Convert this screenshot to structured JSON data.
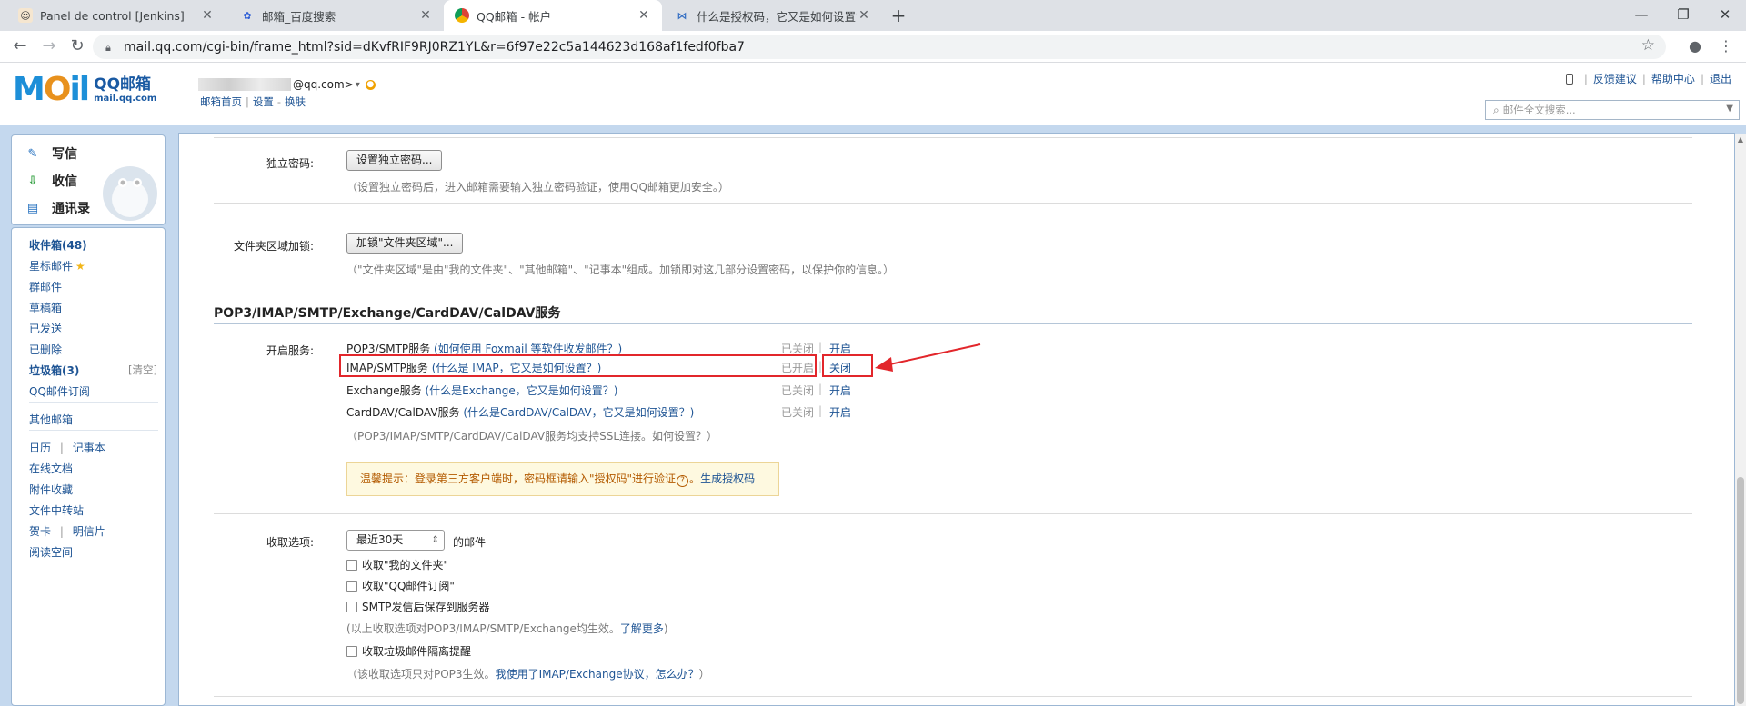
{
  "browser": {
    "tabs": [
      {
        "title": "Panel de control [Jenkins]",
        "icon": "jenkins-icon"
      },
      {
        "title": "邮箱_百度搜索",
        "icon": "baidu-icon"
      },
      {
        "title": "QQ邮箱 - 帐户",
        "icon": "chrome-icon"
      },
      {
        "title": "什么是授权码，它又是如何设置?",
        "icon": "qq-help-icon"
      }
    ],
    "new_tab": "+",
    "url": "mail.qq.com/cgi-bin/frame_html?sid=dKvfRIF9RJ0RZ1YL&r=6f97e22c5a144623d168af1fedf0fba7"
  },
  "header": {
    "logo_text": "MOil",
    "logo_brand": "QQ邮箱",
    "logo_domain": "mail.qq.com",
    "account_suffix": "@qq.com>",
    "account_caret": "▾",
    "sublinks": [
      "邮箱首页",
      "设置",
      "换肤"
    ],
    "sublink_separator": "|",
    "sublink_dash": "-",
    "top_links": [
      "反馈建议",
      "帮助中心",
      "退出"
    ],
    "search_placeholder": "邮件全文搜索..."
  },
  "sidebar": {
    "actions": [
      "写信",
      "收信",
      "通讯录"
    ],
    "folders": [
      {
        "label": "收件箱(48)",
        "bold": true
      },
      {
        "label": "星标邮件",
        "bold": false,
        "star": true
      },
      {
        "label": "群邮件",
        "bold": false
      },
      {
        "label": "草稿箱",
        "bold": false
      },
      {
        "label": "已发送",
        "bold": false
      },
      {
        "label": "已删除",
        "bold": false
      },
      {
        "label": "垃圾箱(3)",
        "bold": true
      },
      {
        "label": "QQ邮件订阅",
        "bold": false
      }
    ],
    "clean_label": "[清空]",
    "other_mailbox": "其他邮箱",
    "calendar": "日历",
    "notes": "记事本",
    "pipe": "|",
    "tools": [
      "在线文档",
      "附件收藏",
      "文件中转站"
    ],
    "card": "贺卡",
    "postcard": "明信片",
    "reading_space": "阅读空间"
  },
  "settings": {
    "independent_password_label": "独立密码:",
    "independent_password_button": "设置独立密码...",
    "independent_password_note": "（设置独立密码后，进入邮箱需要输入独立密码验证，使用QQ邮箱更加安全。）",
    "folder_lock_label": "文件夹区域加锁:",
    "folder_lock_button": "加锁\"文件夹区域\"...",
    "folder_lock_note": "（\"文件夹区域\"是由\"我的文件夹\"、\"其他邮箱\"、\"记事本\"组成。加锁即对这几部分设置密码，以保护你的信息。）",
    "section_title": "POP3/IMAP/SMTP/Exchange/CardDAV/CalDAV服务",
    "enable_service_label": "开启服务:",
    "services": [
      {
        "name": "POP3/SMTP服务",
        "help": "(如何使用 Foxmail 等软件收发邮件？)",
        "state": "已关闭",
        "toggle": "开启"
      },
      {
        "name": "IMAP/SMTP服务",
        "help": "(什么是 IMAP，它又是如何设置？)",
        "state": "已开启",
        "toggle": "关闭"
      },
      {
        "name": "Exchange服务",
        "help": "(什么是Exchange，它又是如何设置？)",
        "state": "已关闭",
        "toggle": "开启"
      },
      {
        "name": "CardDAV/CalDAV服务",
        "help": "(什么是CardDAV/CalDAV，它又是如何设置？)",
        "state": "已关闭",
        "toggle": "开启"
      }
    ],
    "ssl_note": "（POP3/IMAP/SMTP/CardDAV/CalDAV服务均支持SSL连接。如何设置？）",
    "tip_prefix": "温馨提示：登录第三方客户端时，密码框请输入\"授权码\"进行验证",
    "tip_help": "?",
    "tip_link": "生成授权码",
    "tip_end": "。",
    "receive_label": "收取选项:",
    "receive_period": "最近30天",
    "receive_suffix": "的邮件",
    "options": [
      {
        "label": "收取\"我的文件夹\"",
        "checked": false
      },
      {
        "label": "收取\"QQ邮件订阅\"",
        "checked": false
      },
      {
        "label": "SMTP发信后保存到服务器",
        "checked": false
      }
    ],
    "options_note": "(以上收取选项对POP3/IMAP/SMTP/Exchange均生效。",
    "options_note_link": "了解更多",
    "options_note_end": ")",
    "spam_option": "收取垃圾邮件隔离提醒",
    "pop3_note_prefix": "（该收取选项只对POP3生效。",
    "pop3_note_link": "我使用了IMAP/Exchange协议，怎么办？",
    "pop3_note_end": "）"
  },
  "colors": {
    "highlight": "#e2262b",
    "link": "#1e5494",
    "frame_bg": "#c4d8ee"
  }
}
